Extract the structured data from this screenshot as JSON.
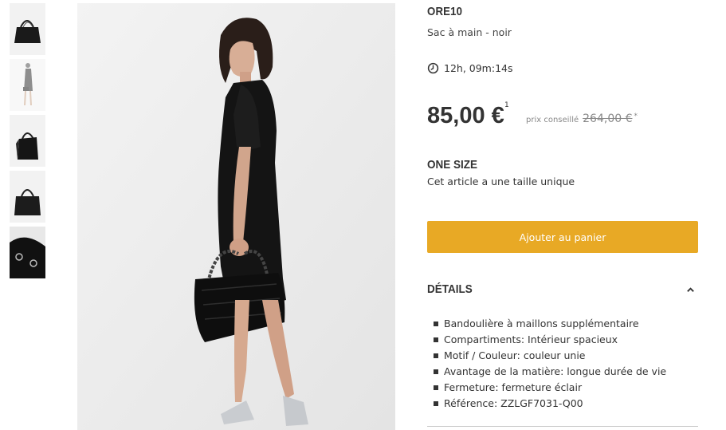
{
  "product": {
    "brand": "ORE10",
    "subtitle": "Sac à main - noir",
    "timer": "12h, 09m:14s",
    "price": "85,00 €",
    "price_note_marker": "1",
    "rrp_label": "prix conseillé",
    "rrp_value": "264,00 €",
    "rrp_marker": "*"
  },
  "size": {
    "title": "ONE SIZE",
    "description": "Cet article a une taille unique"
  },
  "cart": {
    "button_label": "Ajouter au panier"
  },
  "details": {
    "title": "DÉTAILS",
    "items": [
      "Bandoulière à maillons supplémentaire",
      "Compartiments: Intérieur spacieux",
      "Motif / Couleur: couleur unie",
      "Avantage de la matière: longue durée de vie",
      "Fermeture: fermeture éclair",
      "Référence: ZZLGF7031-Q00"
    ]
  },
  "colors": {
    "accent": "#e8a925",
    "text": "#333333",
    "muted": "#888888"
  },
  "icons": {
    "timer": "clock-icon",
    "details_toggle": "chevron-up-icon"
  }
}
